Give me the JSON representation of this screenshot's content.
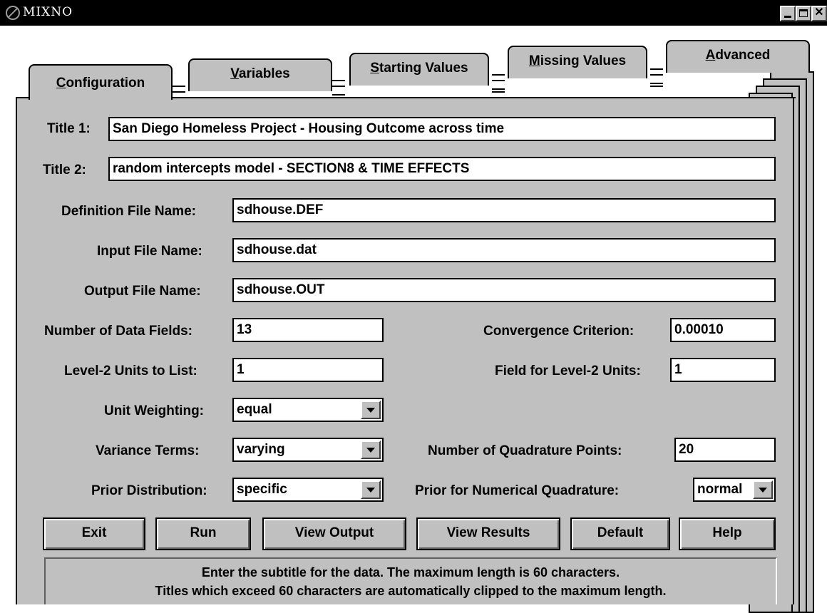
{
  "window": {
    "title": "MIXNO"
  },
  "tabs": [
    {
      "label": "Configuration",
      "mnemonic": "C"
    },
    {
      "label": "Variables",
      "mnemonic": "V"
    },
    {
      "label": "Starting Values",
      "mnemonic": "S"
    },
    {
      "label": "Missing Values",
      "mnemonic": "M"
    },
    {
      "label": "Advanced",
      "mnemonic": "A"
    }
  ],
  "form": {
    "title1_label": "Title 1:",
    "title1_value": "San Diego Homeless Project - Housing Outcome across time",
    "title2_label": "Title 2:",
    "title2_value": "random intercepts model - SECTION8 & TIME EFFECTS",
    "def_label": "Definition File Name:",
    "def_value": "sdhouse.DEF",
    "input_label": "Input File Name:",
    "input_value": "sdhouse.dat",
    "output_label": "Output File Name:",
    "output_value": "sdhouse.OUT",
    "ndf_label": "Number of Data Fields:",
    "ndf_value": "13",
    "conv_label": "Convergence Criterion:",
    "conv_value": "0.00010",
    "l2list_label": "Level-2 Units to List:",
    "l2list_value": "1",
    "l2field_label": "Field for Level-2 Units:",
    "l2field_value": "1",
    "weight_label": "Unit Weighting:",
    "weight_value": "equal",
    "variance_label": "Variance Terms:",
    "variance_value": "varying",
    "nquad_label": "Number of Quadrature Points:",
    "nquad_value": "20",
    "prior_label": "Prior Distribution:",
    "prior_value": "specific",
    "priorquad_label": "Prior for Numerical Quadrature:",
    "priorquad_value": "normal"
  },
  "buttons": {
    "exit": "Exit",
    "run": "Run",
    "view_output": "View Output",
    "view_results": "View Results",
    "default": "Default",
    "help": "Help"
  },
  "status": {
    "line1": "Enter the subtitle for the data.  The maximum length is 60 characters.",
    "line2": "Titles which exceed 60 characters are automatically clipped to the maximum length."
  }
}
